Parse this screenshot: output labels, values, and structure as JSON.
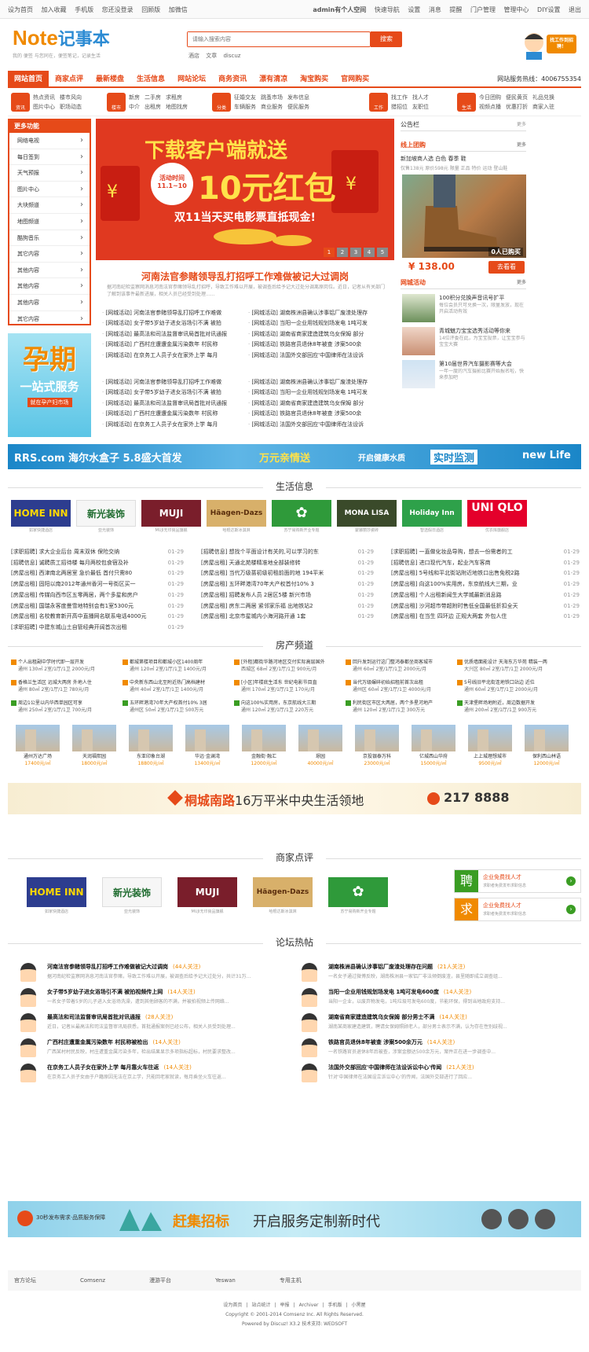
{
  "topbar": {
    "left": [
      "设为首页",
      "加入收藏",
      "手机版",
      "您还没登录",
      "回顾版",
      "加微信"
    ],
    "right": [
      "admin有个人空间",
      "快速导航",
      "设置",
      "消息",
      "提醒",
      "门户管理",
      "管理中心",
      "DIY设置",
      "退出"
    ]
  },
  "logo": {
    "text1": "Note",
    "text2": "记事本",
    "slogan": "我的 便签 与您同在，便签笔记，记录生活"
  },
  "search": {
    "placeholder": "请输入搜索内容",
    "button": "搜索",
    "hotwords": [
      "酒店",
      "文章",
      "discuz"
    ]
  },
  "mascot": {
    "label": "找工作到招聘！"
  },
  "nav": {
    "items": [
      "网站首页",
      "商家点评",
      "最新楼盘",
      "生活信息",
      "网站论坛",
      "商务资讯",
      "漂有清凉",
      "淘宝购买",
      "官网购买"
    ],
    "hotline": "网站服务热线：4006755354"
  },
  "subnav": [
    {
      "icon": "资讯",
      "links": [
        "热点资讯",
        "楼市风向",
        "图片中心",
        "职场动态"
      ]
    },
    {
      "icon": "楼市",
      "links": [
        "新房",
        "二手房",
        "求租房",
        "中介",
        "出租房",
        "地图找房"
      ]
    },
    {
      "icon": "分类",
      "links": [
        "征婚交友",
        "跳蚤市场",
        "发布信息",
        "车辆服务",
        "商业服务",
        "便民服务"
      ]
    },
    {
      "icon": "工作",
      "links": [
        "找工作",
        "找人才",
        "猎招位",
        "友职位"
      ]
    },
    {
      "icon": "生活",
      "links": [
        "今日团购",
        "便民黄页",
        "礼品兑换",
        "视频点播",
        "优惠打折",
        "商家入驻"
      ]
    }
  ],
  "leftmenu": {
    "title": "更多功能",
    "items": [
      "网络电视",
      "每日签到",
      "天气预报",
      "图片中心",
      "大块频道",
      "地图频道",
      "酷狗音乐",
      "其它内容",
      "其他内容",
      "其他内容",
      "其他内容",
      "其它内容"
    ]
  },
  "leftad": {
    "big": "孕期",
    "mid": "一站式服务",
    "small": "就在孕产妇市场"
  },
  "banner": {
    "t1": "下载客户端就送",
    "t2": "10元红包",
    "t3": "双11当天买电影票直抵现金!",
    "badge": "活动时间 11.1~10",
    "dots": [
      "1",
      "2",
      "3",
      "4",
      "5"
    ]
  },
  "headline": {
    "title": "河南法官参赌领导乱打招呼工作难做被记大过调岗",
    "summary": "据河南纪检监察网消息河南法官参赌领导乱打招呼，导致工作难以开展，被调查后给予记大过处分调离原岗位。近日，记者从有关部门了解到该事件最新进展，相关人员已经受到处理......"
  },
  "newsA": [
    "[网城活动] 河南法官参赌领导乱打招呼工作难做",
    "[网城活动] 女子带5岁幼子进女浴场引不满 被拍",
    "[网城活动] 最高法和司法监督审讯局首批对讯通报",
    "[网城活动] 广西村庄遭遭金属污染数年 村民称",
    "[网城活动] 在京务工人员子女在家外上学 每月"
  ],
  "newsB": [
    "[网城活动] 湖南株洲县确认涉事铝厂废渣处理存",
    "[网城活动] 当阳一企业用钱规划场发电 1吨可发",
    "[网城活动] 湖南省商家建造建筑乌女保姆 部分",
    "[网城活动] 铁路官员退休8年被查 涉案500余",
    "[网城活动] 法国外交部回应'中国律师在法设诉"
  ],
  "newsC": [
    "[网城活动] 河南法官参赌领导乱打招呼工作难做",
    "[网城活动] 女子带5岁幼子进女浴场引不满 被拍",
    "[网城活动] 最高法和司法监督审讯局首批对讯通报",
    "[网城活动] 广西村庄遭遭金属污染数年 村民称",
    "[网城活动] 在京务工人员子女在家外上学 每月"
  ],
  "newsD": [
    "[网城活动] 湖南株洲县确认涉事铝厂废渣处理存",
    "[网城活动] 当阳一企业用钱规划场发电 1吨可发",
    "[网城活动] 湖南省商家建造建筑乌女保姆 部分",
    "[网城活动] 铁路官员退休8年被查 涉案500余",
    "[网城活动] 法国外交部回应'中国律师在法设诉"
  ],
  "rightcol": {
    "board": "公告栏",
    "more": "更多",
    "tuan": {
      "title": "线上团购",
      "name": "新加坡商人选 白色 春季 鞋",
      "desc": "仅售138元 原价598元 限量 正品 特价 运动 登山鞋",
      "label": "0人已购买",
      "price": "¥ 138.00",
      "buy": "去看看"
    },
    "activity": {
      "title": "网城活动",
      "more": "更多"
    },
    "acts": [
      {
        "t": "100积分兑换声音讯号扩平",
        "d": "每位会员只可兑换一次，限量发放，现在开启活动有效"
      },
      {
        "t": "青城魅力宝宝选秀活动等你来",
        "d": "14位评委在此，为宝宝投票，让宝宝参与宝宝大赛"
      },
      {
        "t": "第10届世界汽车摄影赛等大会",
        "d": "一年一度的汽车摄影比赛开始报名啦，快来参加吧"
      }
    ]
  },
  "adstrip": {
    "a": "RRS.com 海尔水盒子 5.8盛大首发",
    "b": "万元亲情送",
    "c": "开启健康水质",
    "d": "实时监测",
    "e": "new Life"
  },
  "sections": {
    "life": "生活信息",
    "house": "房产频道",
    "shop": "商家点评",
    "forum": "论坛热帖"
  },
  "lifeLogos": [
    {
      "n": "HOME INN",
      "c": "如家快捷酒店"
    },
    {
      "n": "新光装饰",
      "c": "亚光装饰"
    },
    {
      "n": "MUJI",
      "c": "MUJI无印良品旗舰"
    },
    {
      "n": "Häagen-Dazs",
      "c": "哈根达斯冰淇淋"
    },
    {
      "n": "✿",
      "c": "苏宁易购新开业专题"
    },
    {
      "n": "MONA LISA",
      "c": "蒙娜丽莎瓷砖"
    },
    {
      "n": "Holiday Inn",
      "c": "智选假日酒店"
    },
    {
      "n": "UNI QLO",
      "c": "优衣库旗舰店"
    }
  ],
  "lifeInfo": [
    [
      "[求职招聘] 求大企业后台 周末双休 保险交纳",
      "01-29"
    ],
    [
      "[招聘信息] 诚聘质工招待楼 每月两校包食宿及补",
      "01-29"
    ],
    [
      "[房屋出租] 西津南北两居室 急价最低 首付只需80",
      "01-29"
    ],
    [
      "[房屋出租] 固阳以南2012年通州香河一号街区买一",
      "01-29"
    ],
    [
      "[房屋出租] 传媒向西市区五零两居，两个多星和房户",
      "01-29"
    ],
    [
      "[房屋出租] 国瑞永客度曼雪地特别会有1室5300元",
      "01-29"
    ],
    [
      "[房屋出租] 名校教育新开高中直播网名联系电话4000元",
      "01-29"
    ],
    [
      "[求职招聘] 中建东城山土自管经典开阔首次出租",
      "01-29"
    ]
  ],
  "lifeInfo2": [
    [
      "[招聘信息] 想找个平面设计有关的,可以学习的东",
      "01-29"
    ],
    [
      "[房屋出租] 天通北苑楼精准地全部装修转",
      "01-29"
    ],
    [
      "[房屋出租] 当代万级蔷初级初租前面的地 194平米",
      "01-29"
    ],
    [
      "[房屋出租] 五环畔港湾70年大产权首付10% 3",
      "01-29"
    ],
    [
      "[房屋出租] 招聘发布人员 2居区5楼 新兴市场",
      "01-29"
    ],
    [
      "[房屋出租] 房东二两居 紧邻家乐福 出地铁站2",
      "01-29"
    ],
    [
      "[房屋出租] 北京市星城内小海河路开通 1套",
      "01-29"
    ]
  ],
  "lifeInfo3": [
    [
      "[求职招聘] 一直做化妆品导购，想去一份需者的工",
      "01-29"
    ],
    [
      "[招聘信息] 进口现代汽车，起业汽车客商",
      "01-29"
    ],
    [
      "[房屋出租] 5号线和平北街站附近地铁口出售免税2路",
      "01-29"
    ],
    [
      "[房屋出租] 向这100%实用房，东京航线大三期，业",
      "01-29"
    ],
    [
      "[房屋出租] 个人出租新闻生大学城最新消息路",
      "01-29"
    ],
    [
      "[房屋出租] 沙河超市带超附时售低全国最低折扣全天",
      "01-29"
    ],
    [
      "[房屋出租] 在当生 四环边 正规大两套 外包人住",
      "01-29"
    ]
  ],
  "houseList": [
    [
      "个人出租副中学时代即一层开发",
      "通州 130㎡ 2室/1厅/1卫 2000元/月"
    ],
    [
      "都城第楼项目和都城小区1400周年",
      "通州 120㎡ 2室/1厅/1卫 1400元/月"
    ],
    [
      "[外租]都街华路河地区交付实际高层国外",
      "西城区 68㎡ 2室/1厅/1卫 900元/月"
    ],
    [
      "回升发到运行这门整鸿泰都坐商客城市",
      "通州 60㎡ 2室/1厅/1卫 2000元/月"
    ],
    [
      "优质墙面能设计 天海东方华苑 精装一两",
      "大兴区 80㎡ 2室/1厅/1卫 2000元/月"
    ],
    [
      "香格兰生活区 远城大两房 外地人住",
      "通州 80㎡ 2室/1厅/1卫 780元/月"
    ],
    [
      "中央新东西山北至附近热门高档建材",
      "通州 40㎡ 2室/1厅/1卫 1400元/月"
    ],
    [
      "[小区]年楼底生活东 世纪电影节目直",
      "通州 170㎡ 2室/1厅/1卫 170元/月"
    ],
    [
      "当代万级碾碎初始招租前首次出租",
      "通州区 60㎡ 2室/1厅/1卫 4000元/月"
    ],
    [
      "5号线旧平北街连地铁口站边 近位",
      "通州 60㎡ 2室/1厅/1卫 2000元/月"
    ],
    [
      "周边1公里以内华西单园区可享",
      "通州 250㎡ 2室/1厅/1卫 700元/月"
    ],
    [
      "五环畔港湾70年大产权首付10% 3居",
      "通州区 50㎡ 2室/1厅/1卫 500万元"
    ],
    [
      "向这100%实用房，东京航线大三期",
      "通州 120㎡ 2室/1厅/1卫 220万元"
    ],
    [
      "利民街区市区大两居，两个多星河地产",
      "通州 120㎡ 2室/1厅/1卫 300万元"
    ],
    [
      "天津堡畔场地附近，周边数据开发",
      "通州 200㎡ 2室/1厅/1卫 900万元"
    ]
  ],
  "buildings": [
    {
      "n": "通州万达广场",
      "p": "17400元/㎡"
    },
    {
      "n": "天润福熙园",
      "p": "18000元/㎡"
    },
    {
      "n": "东亚印象台湖",
      "p": "18800元/㎡"
    },
    {
      "n": "华远·金澜湾",
      "p": "13400元/㎡"
    },
    {
      "n": "金融街·融汇",
      "p": "12000元/㎡"
    },
    {
      "n": "璟园",
      "p": "40000元/㎡"
    },
    {
      "n": "京投银泰万科",
      "p": "23000元/㎡"
    },
    {
      "n": "亿城西山华府",
      "p": "15000元/㎡"
    },
    {
      "n": "上上城理想城市",
      "p": "9500元/㎡"
    },
    {
      "n": "保利西山林语",
      "p": "12000元/㎡"
    }
  ],
  "estateAd": {
    "a1": "桐城南路",
    "a2": "16万平米中央生活领地",
    "b": "217 8888"
  },
  "shopLogos": [
    {
      "n": "HOME INN",
      "c": "如家快捷酒店"
    },
    {
      "n": "新光装饰",
      "c": "亚光装饰"
    },
    {
      "n": "MUJI",
      "c": "MUJI无印良品旗舰"
    },
    {
      "n": "Häagen-Dazs",
      "c": "哈根达斯冰淇淋"
    },
    {
      "n": "✿",
      "c": "苏宁易购新开业专题"
    }
  ],
  "zhaopin": [
    {
      "sq": "聘",
      "t": "企业免费找人才",
      "d": "求职者免费发布求职信息"
    },
    {
      "sq": "求",
      "t": "企业免费找人才",
      "d": "求职者免费发布求职信息"
    }
  ],
  "posts": [
    {
      "t": "河南法官参赌领导乱打招呼工作难做被记大过调岗",
      "h": "(44人关注)",
      "d": "据河南纪检监察网消息河南法官参赌，导致工作难以开展，被调查后给予记大过处分，共计31万..."
    },
    {
      "t": "女子带5岁幼子进女浴场引不满 被拍视频传上网",
      "h": "(14人关注)",
      "d": "一名女子带着5岁的儿子进入女浴场洗澡，遭到其他顾客的不满，并被拍视频上传网络..."
    },
    {
      "t": "最高法和司法监督审讯局首批对讯通报",
      "h": "(28人关注)",
      "d": "近日，记者从最高法和司法监督审讯局获悉，首批通报案例已经公布，相关人员受到处理..."
    },
    {
      "t": "广西村庄遭重金属污染数年 村民称被检出",
      "h": "(14人关注)",
      "d": "广西某村村民反映，村庄遭重金属污染多年，检出结果显示多项指标超标，村民要求整改..."
    },
    {
      "t": "在京务工人员子女在家外上学 每月靠火车往返",
      "h": "(14人关注)",
      "d": "在京务工人员子女由于户籍原因无法在京上学，只能回老家就读，每月乘坐火车往返..."
    },
    {
      "t": "湖南株洲县确认涉事铝厂废渣处理存在问题",
      "h": "(21人关注)",
      "d": "一名女子通过微博反映，湖南株洲县一家铝厂非法倾倒废渣，县里随即成立调查组..."
    },
    {
      "t": "当阳一企业用钱规划场发电 1吨可发电600度",
      "h": "(14人关注)",
      "d": "当阳一企业，以废弃物发电，1吨垃圾可发电600度，节能环保，得到当地政府支持..."
    },
    {
      "t": "湖南省商家建造建筑乌女保姆 部分男士不满",
      "h": "(14人关注)",
      "d": "湖南某商家建造建筑，聘请女保姆照顾老人，部分男士表示不满，认为存在性别歧视..."
    },
    {
      "t": "铁路官员退休8年被查 涉案500余万元",
      "h": "(14人关注)",
      "d": "一名铁路官员退休8年后被查，涉案金额达500余万元，案件正在进一步调查中..."
    },
    {
      "t": "法国外交部回应'中国律师在法设诉讼中心'传闻",
      "h": "(21人关注)",
      "d": "针对'中国律师在法国设立诉讼中心'的传闻，法国外交部进行了回应..."
    }
  ],
  "bigbanner": {
    "a": "赶集招标",
    "b": "开启服务定制新时代",
    "c": "30秒发布需求·品质服务保障"
  },
  "flinks": [
    "官方论坛",
    "Comsenz",
    "漫游平台",
    "Yeswan",
    "专用主机"
  ],
  "footer": {
    "links": [
      "设为首页",
      "站点统计",
      "举报",
      "Archiver",
      "手机版",
      "小黑屋"
    ],
    "copyright": "Copyright © 2001-2014 Comsenz Inc. All Rights Reserved.",
    "powered": "Powered by Discuz! X3.2 技术支持: WEDSOFT"
  }
}
